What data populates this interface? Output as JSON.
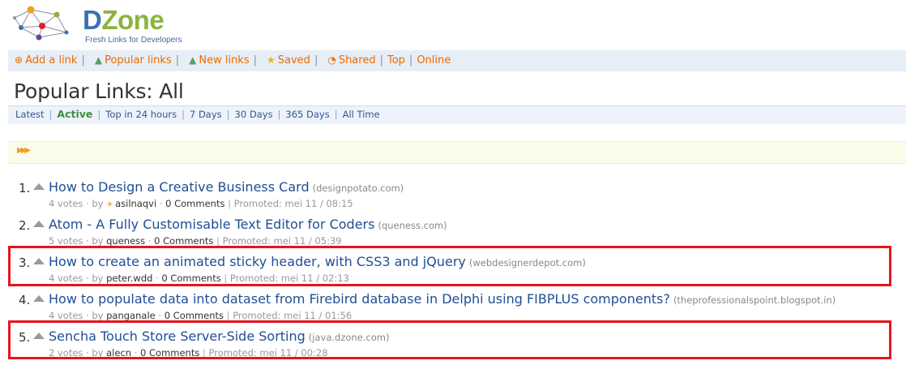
{
  "brand": {
    "name_part1": "D",
    "name_part2": "Zone",
    "tagline": "Fresh Links for Developers",
    "colors": {
      "blue": "#3c6fb4",
      "green": "#8cb43a",
      "orange": "#e86b00",
      "link": "#1f4e96",
      "highlight": "#e8141d"
    }
  },
  "nav": {
    "items": [
      {
        "icon": "plus-circle-icon",
        "label": "Add a link"
      },
      {
        "icon": "popular-icon",
        "label": "Popular links"
      },
      {
        "icon": "new-icon",
        "label": "New links"
      },
      {
        "icon": "star-icon",
        "label": "Saved"
      },
      {
        "icon": "rss-icon",
        "label": "Shared"
      },
      {
        "icon": "",
        "label": "Top"
      },
      {
        "icon": "",
        "label": "Online"
      }
    ],
    "separator": "|"
  },
  "page": {
    "title": "Popular Links: All"
  },
  "subnav": {
    "items": [
      {
        "label": "Latest",
        "active": false
      },
      {
        "label": "Active",
        "active": true
      },
      {
        "label": "Top in 24 hours",
        "active": false
      },
      {
        "label": "7 Days",
        "active": false
      },
      {
        "label": "30 Days",
        "active": false
      },
      {
        "label": "365 Days",
        "active": false
      },
      {
        "label": "All Time",
        "active": false
      }
    ],
    "separator": "|"
  },
  "links": [
    {
      "num": "1.",
      "title": "How to Design a Creative Business Card",
      "domain": "(designpotato.com)",
      "votes": "4 votes",
      "by": "by",
      "user": "asilnaqvi",
      "comments": "0 Comments",
      "promoted": "Promoted: mei 11 / 08:15",
      "user_icon": "bulb-icon",
      "highlighted": false
    },
    {
      "num": "2.",
      "title": "Atom - A Fully Customisable Text Editor for Coders",
      "domain": "(queness.com)",
      "votes": "5 votes",
      "by": "by",
      "user": "queness",
      "comments": "0 Comments",
      "promoted": "Promoted: mei 11 / 05:39",
      "highlighted": false
    },
    {
      "num": "3.",
      "title": "How to create an animated sticky header, with CSS3 and jQuery",
      "domain": "(webdesignerdepot.com)",
      "votes": "4 votes",
      "by": "by",
      "user": "peter.wdd",
      "comments": "0 Comments",
      "promoted": "Promoted: mei 11 / 02:13",
      "highlighted": true
    },
    {
      "num": "4.",
      "title": "How to populate data into dataset from Firebird database in Delphi using FIBPLUS components?",
      "domain": "(theprofessionalspoint.blogspot.in)",
      "votes": "4 votes",
      "by": "by",
      "user": "panganale",
      "comments": "0 Comments",
      "promoted": "Promoted: mei 11 / 01:56",
      "highlighted": false
    },
    {
      "num": "5.",
      "title": "Sencha Touch Store Server-Side Sorting",
      "domain": "(java.dzone.com)",
      "votes": "2 votes",
      "by": "by",
      "user": "alecn",
      "comments": "0 Comments",
      "promoted": "Promoted: mei 11 / 00:28",
      "highlighted": true
    }
  ],
  "meta_separator": "·",
  "meta_pipe": "|"
}
